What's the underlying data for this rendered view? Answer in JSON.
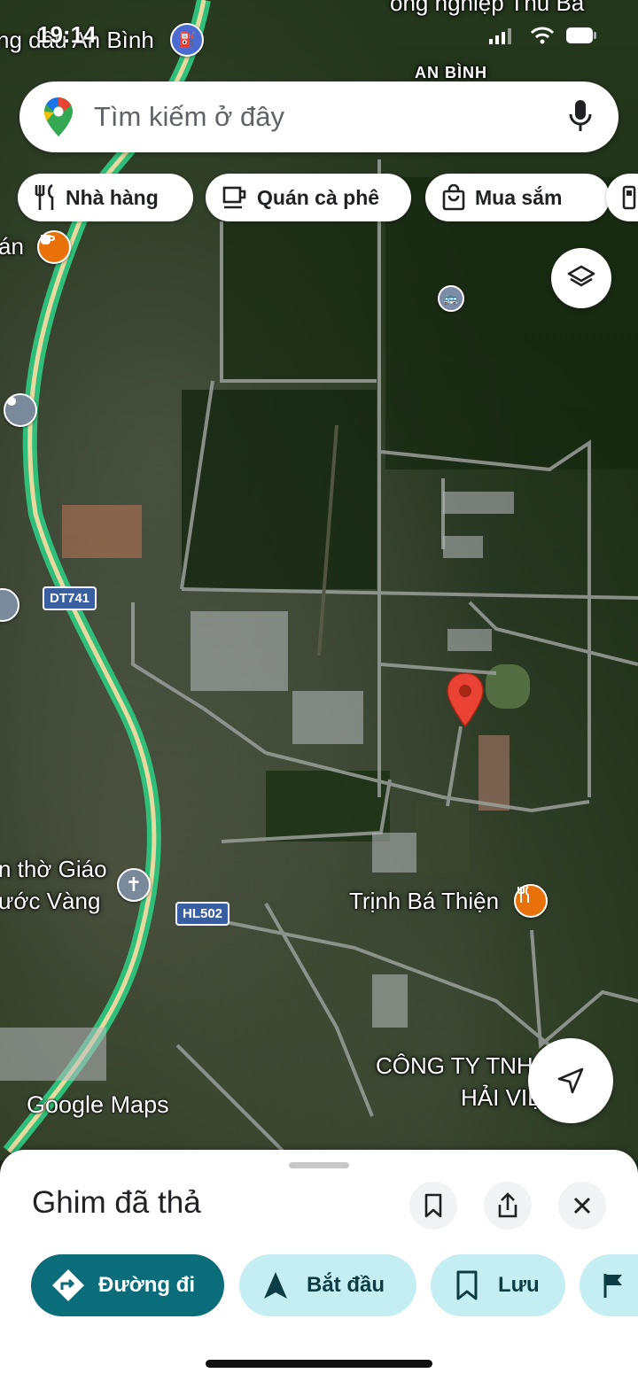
{
  "status_bar": {
    "time": "19:14"
  },
  "search": {
    "placeholder": "Tìm kiếm ở đây"
  },
  "chips": [
    {
      "label": "Nhà hàng",
      "icon": "utensils-icon"
    },
    {
      "label": "Quán cà phê",
      "icon": "coffee-cup-icon"
    },
    {
      "label": "Mua sắm",
      "icon": "shopping-bag-icon"
    }
  ],
  "map": {
    "labels": {
      "top_left": "ng dầu An Bình",
      "top_right": "ông nghiệp Thu Bá",
      "district": "AN BÌNH",
      "cafe_partial": "án",
      "church_line1": "n thờ Giáo",
      "church_line2": "ước Vàng",
      "restaurant": "Trịnh Bá Thiện",
      "company_line1": "CÔNG TY TNH",
      "company_line2": "HẢI VIỆ"
    },
    "road_badges": {
      "dt741": "DT741",
      "hl502": "HL502"
    },
    "attribution": "Google Maps"
  },
  "sheet": {
    "title": "Ghim đã thả",
    "actions": {
      "directions": "Đường đi",
      "start": "Bắt đầu",
      "save": "Lưu"
    }
  },
  "colors": {
    "primary_button": "#0b6c7a",
    "secondary_button": "#c5eef3",
    "pin": "#ea4335",
    "route": "#34c47c"
  }
}
